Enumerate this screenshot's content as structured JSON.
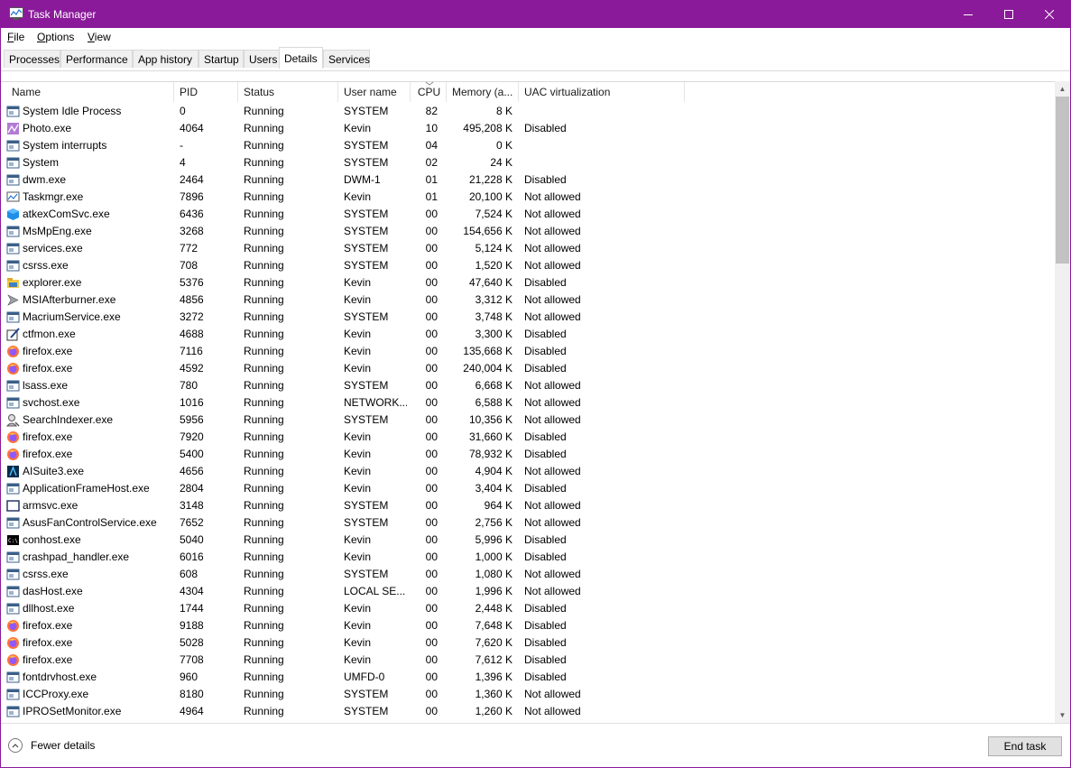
{
  "window": {
    "title": "Task Manager",
    "accent": "#8a1a9a"
  },
  "menu": [
    {
      "key": "F",
      "rest": "ile"
    },
    {
      "key": "O",
      "rest": "ptions"
    },
    {
      "key": "V",
      "rest": "iew"
    }
  ],
  "tabs": [
    "Processes",
    "Performance",
    "App history",
    "Startup",
    "Users",
    "Details",
    "Services"
  ],
  "active_tab": "Details",
  "columns": [
    "Name",
    "PID",
    "Status",
    "User name",
    "CPU",
    "Memory (a...",
    "UAC virtualization"
  ],
  "rows": [
    {
      "name": "System Idle Process",
      "pid": "0",
      "status": "Running",
      "user": "SYSTEM",
      "cpu": "82",
      "mem": "8 K",
      "uac": "",
      "icon": "window-icon"
    },
    {
      "name": "Photo.exe",
      "pid": "4064",
      "status": "Running",
      "user": "Kevin",
      "cpu": "10",
      "mem": "495,208 K",
      "uac": "Disabled",
      "icon": "photo-icon"
    },
    {
      "name": "System interrupts",
      "pid": "-",
      "status": "Running",
      "user": "SYSTEM",
      "cpu": "04",
      "mem": "0 K",
      "uac": "",
      "icon": "window-icon"
    },
    {
      "name": "System",
      "pid": "4",
      "status": "Running",
      "user": "SYSTEM",
      "cpu": "02",
      "mem": "24 K",
      "uac": "",
      "icon": "window-icon"
    },
    {
      "name": "dwm.exe",
      "pid": "2464",
      "status": "Running",
      "user": "DWM-1",
      "cpu": "01",
      "mem": "21,228 K",
      "uac": "Disabled",
      "icon": "window-icon"
    },
    {
      "name": "Taskmgr.exe",
      "pid": "7896",
      "status": "Running",
      "user": "Kevin",
      "cpu": "01",
      "mem": "20,100 K",
      "uac": "Not allowed",
      "icon": "taskmgr-icon"
    },
    {
      "name": "atkexComSvc.exe",
      "pid": "6436",
      "status": "Running",
      "user": "SYSTEM",
      "cpu": "00",
      "mem": "7,524 K",
      "uac": "Not allowed",
      "icon": "cube-icon"
    },
    {
      "name": "MsMpEng.exe",
      "pid": "3268",
      "status": "Running",
      "user": "SYSTEM",
      "cpu": "00",
      "mem": "154,656 K",
      "uac": "Not allowed",
      "icon": "window-icon"
    },
    {
      "name": "services.exe",
      "pid": "772",
      "status": "Running",
      "user": "SYSTEM",
      "cpu": "00",
      "mem": "5,124 K",
      "uac": "Not allowed",
      "icon": "window-icon"
    },
    {
      "name": "csrss.exe",
      "pid": "708",
      "status": "Running",
      "user": "SYSTEM",
      "cpu": "00",
      "mem": "1,520 K",
      "uac": "Not allowed",
      "icon": "window-icon"
    },
    {
      "name": "explorer.exe",
      "pid": "5376",
      "status": "Running",
      "user": "Kevin",
      "cpu": "00",
      "mem": "47,640 K",
      "uac": "Disabled",
      "icon": "folder-icon"
    },
    {
      "name": "MSIAfterburner.exe",
      "pid": "4856",
      "status": "Running",
      "user": "Kevin",
      "cpu": "00",
      "mem": "3,312 K",
      "uac": "Not allowed",
      "icon": "jet-icon"
    },
    {
      "name": "MacriumService.exe",
      "pid": "3272",
      "status": "Running",
      "user": "SYSTEM",
      "cpu": "00",
      "mem": "3,748 K",
      "uac": "Not allowed",
      "icon": "window-icon"
    },
    {
      "name": "ctfmon.exe",
      "pid": "4688",
      "status": "Running",
      "user": "Kevin",
      "cpu": "00",
      "mem": "3,300 K",
      "uac": "Disabled",
      "icon": "pen-icon"
    },
    {
      "name": "firefox.exe",
      "pid": "7116",
      "status": "Running",
      "user": "Kevin",
      "cpu": "00",
      "mem": "135,668 K",
      "uac": "Disabled",
      "icon": "firefox-icon"
    },
    {
      "name": "firefox.exe",
      "pid": "4592",
      "status": "Running",
      "user": "Kevin",
      "cpu": "00",
      "mem": "240,004 K",
      "uac": "Disabled",
      "icon": "firefox-icon"
    },
    {
      "name": "lsass.exe",
      "pid": "780",
      "status": "Running",
      "user": "SYSTEM",
      "cpu": "00",
      "mem": "6,668 K",
      "uac": "Not allowed",
      "icon": "window-icon"
    },
    {
      "name": "svchost.exe",
      "pid": "1016",
      "status": "Running",
      "user": "NETWORK...",
      "cpu": "00",
      "mem": "6,588 K",
      "uac": "Not allowed",
      "icon": "window-icon"
    },
    {
      "name": "SearchIndexer.exe",
      "pid": "5956",
      "status": "Running",
      "user": "SYSTEM",
      "cpu": "00",
      "mem": "10,356 K",
      "uac": "Not allowed",
      "icon": "search-user-icon"
    },
    {
      "name": "firefox.exe",
      "pid": "7920",
      "status": "Running",
      "user": "Kevin",
      "cpu": "00",
      "mem": "31,660 K",
      "uac": "Disabled",
      "icon": "firefox-icon"
    },
    {
      "name": "firefox.exe",
      "pid": "5400",
      "status": "Running",
      "user": "Kevin",
      "cpu": "00",
      "mem": "78,932 K",
      "uac": "Disabled",
      "icon": "firefox-icon"
    },
    {
      "name": "AISuite3.exe",
      "pid": "4656",
      "status": "Running",
      "user": "Kevin",
      "cpu": "00",
      "mem": "4,904 K",
      "uac": "Not allowed",
      "icon": "aisuite-icon"
    },
    {
      "name": "ApplicationFrameHost.exe",
      "pid": "2804",
      "status": "Running",
      "user": "Kevin",
      "cpu": "00",
      "mem": "3,404 K",
      "uac": "Disabled",
      "icon": "window-icon"
    },
    {
      "name": "armsvc.exe",
      "pid": "3148",
      "status": "Running",
      "user": "SYSTEM",
      "cpu": "00",
      "mem": "964 K",
      "uac": "Not allowed",
      "icon": "frame-icon"
    },
    {
      "name": "AsusFanControlService.exe",
      "pid": "7652",
      "status": "Running",
      "user": "SYSTEM",
      "cpu": "00",
      "mem": "2,756 K",
      "uac": "Not allowed",
      "icon": "window-icon"
    },
    {
      "name": "conhost.exe",
      "pid": "5040",
      "status": "Running",
      "user": "Kevin",
      "cpu": "00",
      "mem": "5,996 K",
      "uac": "Disabled",
      "icon": "console-icon"
    },
    {
      "name": "crashpad_handler.exe",
      "pid": "6016",
      "status": "Running",
      "user": "Kevin",
      "cpu": "00",
      "mem": "1,000 K",
      "uac": "Disabled",
      "icon": "window-icon"
    },
    {
      "name": "csrss.exe",
      "pid": "608",
      "status": "Running",
      "user": "SYSTEM",
      "cpu": "00",
      "mem": "1,080 K",
      "uac": "Not allowed",
      "icon": "window-icon"
    },
    {
      "name": "dasHost.exe",
      "pid": "4304",
      "status": "Running",
      "user": "LOCAL SE...",
      "cpu": "00",
      "mem": "1,996 K",
      "uac": "Not allowed",
      "icon": "window-icon"
    },
    {
      "name": "dllhost.exe",
      "pid": "1744",
      "status": "Running",
      "user": "Kevin",
      "cpu": "00",
      "mem": "2,448 K",
      "uac": "Disabled",
      "icon": "window-icon"
    },
    {
      "name": "firefox.exe",
      "pid": "9188",
      "status": "Running",
      "user": "Kevin",
      "cpu": "00",
      "mem": "7,648 K",
      "uac": "Disabled",
      "icon": "firefox-icon"
    },
    {
      "name": "firefox.exe",
      "pid": "5028",
      "status": "Running",
      "user": "Kevin",
      "cpu": "00",
      "mem": "7,620 K",
      "uac": "Disabled",
      "icon": "firefox-icon"
    },
    {
      "name": "firefox.exe",
      "pid": "7708",
      "status": "Running",
      "user": "Kevin",
      "cpu": "00",
      "mem": "7,612 K",
      "uac": "Disabled",
      "icon": "firefox-icon"
    },
    {
      "name": "fontdrvhost.exe",
      "pid": "960",
      "status": "Running",
      "user": "UMFD-0",
      "cpu": "00",
      "mem": "1,396 K",
      "uac": "Disabled",
      "icon": "window-icon"
    },
    {
      "name": "ICCProxy.exe",
      "pid": "8180",
      "status": "Running",
      "user": "SYSTEM",
      "cpu": "00",
      "mem": "1,360 K",
      "uac": "Not allowed",
      "icon": "window-icon"
    },
    {
      "name": "IPROSetMonitor.exe",
      "pid": "4964",
      "status": "Running",
      "user": "SYSTEM",
      "cpu": "00",
      "mem": "1,260 K",
      "uac": "Not allowed",
      "icon": "window-icon"
    }
  ],
  "footer": {
    "fewer_details": "Fewer details",
    "end_task": "End task"
  }
}
